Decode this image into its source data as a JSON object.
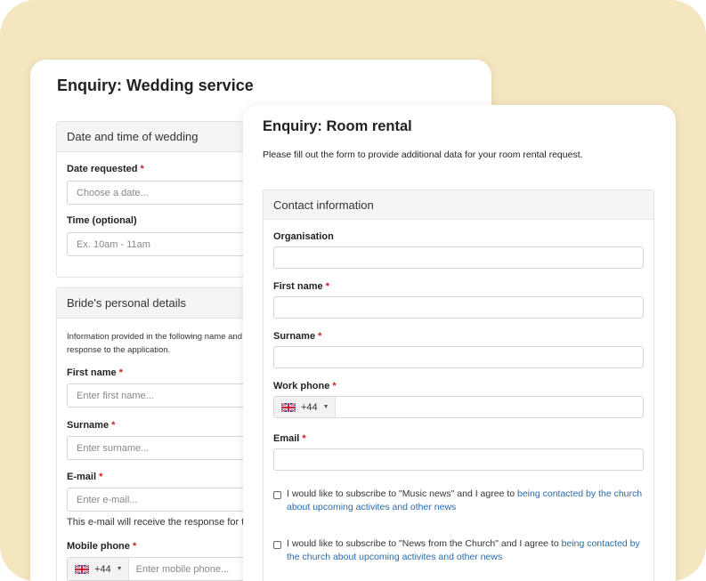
{
  "wedding": {
    "title": "Enquiry: Wedding service",
    "date_section": {
      "heading": "Date and time of wedding",
      "date_label": "Date requested",
      "date_placeholder": "Choose a date...",
      "time_label": "Time (optional)",
      "time_placeholder": "Ex. 10am - 11am"
    },
    "bride_section": {
      "heading": "Bride's personal details",
      "info_line1": "Information provided in the following name and",
      "info_line2": "response to the application.",
      "first_name_label": "First name",
      "first_name_placeholder": "Enter first name...",
      "surname_label": "Surname",
      "surname_placeholder": "Enter surname...",
      "email_label": "E-mail",
      "email_placeholder": "Enter e-mail...",
      "email_hint": "This e-mail will receive the response for t",
      "mobile_label": "Mobile phone",
      "mobile_prefix": "+44",
      "mobile_placeholder": "Enter mobile phone..."
    }
  },
  "room": {
    "title": "Enquiry: Room rental",
    "intro": "Please fill out the form to provide additional data for your room rental request.",
    "contact_section": {
      "heading": "Contact information",
      "organisation_label": "Organisation",
      "first_name_label": "First name",
      "surname_label": "Surname",
      "work_phone_label": "Work phone",
      "work_phone_prefix": "+44",
      "email_label": "Email"
    },
    "subscriptions": [
      {
        "text": "I would like to subscribe to \"Music news\" and I agree to ",
        "link": "being contacted by the church about upcoming activites and other news"
      },
      {
        "text": "I would like to subscribe to \"News from the Church\" and I agree to ",
        "link": "being contacted by the church about upcoming activites and other news"
      }
    ]
  },
  "required_marker": "*",
  "colors": {
    "background": "#f4e6bf",
    "required": "#cc2222",
    "link": "#2b6aa8"
  },
  "icons": {
    "phone_flag": "uk-flag-icon",
    "dropdown": "caret-down-icon"
  }
}
